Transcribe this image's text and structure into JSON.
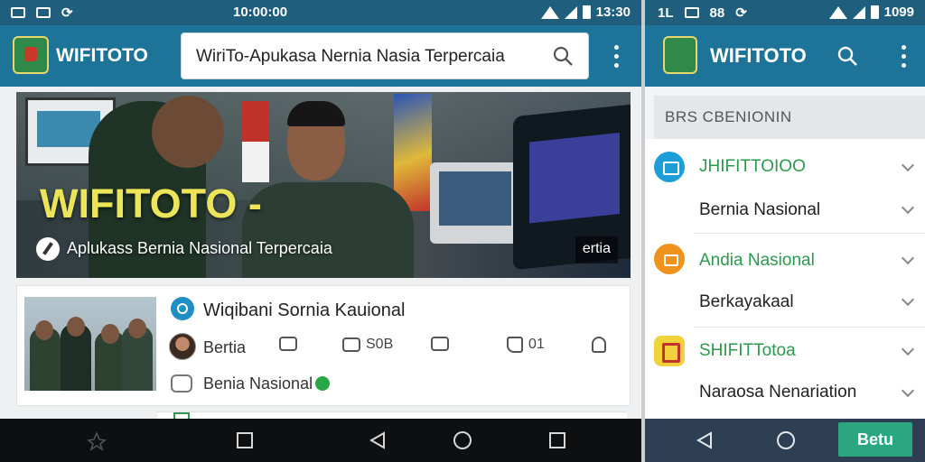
{
  "left": {
    "status": {
      "time": "10:00:00"
    },
    "appbar": {
      "brand": "WIFITOTO",
      "search_value": "WiriTo-Apukasa Nernia Nasia Terpercaia"
    },
    "hero": {
      "title": "WIFITOTO -",
      "subtitle": "Aplukass Bernia Nasional Terpercaia",
      "badge": "ertia"
    },
    "card": {
      "title": "Wiqibani Sornia Kauional",
      "author": "Bertia",
      "actions": [
        {
          "label": ""
        },
        {
          "label": "S0B"
        },
        {
          "label": ""
        },
        {
          "label": "01"
        }
      ],
      "category": "Benia Nasional"
    }
  },
  "right": {
    "status": {
      "time": "1099"
    },
    "appbar": {
      "brand": "WIFITOTO"
    },
    "section_label": "BRS CBENIONIN",
    "items": [
      {
        "label": "JHIFITTOIOO",
        "color": "green",
        "icon": "news-icon"
      },
      {
        "label": "Bernia Nasional",
        "color": "dark"
      },
      {
        "label": "Andia Nasional",
        "color": "green",
        "icon": "wallet-icon"
      },
      {
        "label": "Berkayakaal",
        "color": "dark"
      },
      {
        "label": "SHIFITTotoa",
        "color": "green",
        "icon": "flag-icon"
      },
      {
        "label": "Naraosa Nenariation",
        "color": "dark"
      }
    ],
    "button": "Betu"
  }
}
